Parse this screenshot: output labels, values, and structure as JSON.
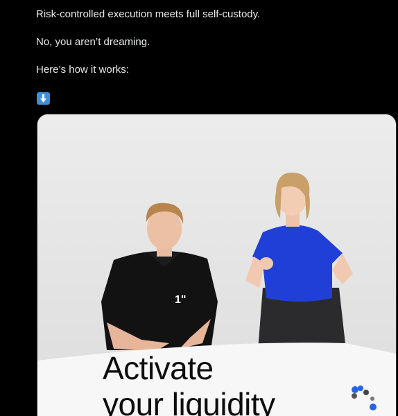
{
  "tweet": {
    "lines": [
      "Risk-controlled execution meets full self-custody.",
      "No, you aren’t dreaming.",
      "Here’s how it works:"
    ],
    "emoji": "down-arrow-emoji"
  },
  "media": {
    "caption_line1": "Activate",
    "caption_line2": "your liquidity",
    "shirt_logo": "1\"",
    "colors": {
      "background": "#e6e6e6",
      "man_shirt": "#111111",
      "woman_shirt": "#1f3fd6",
      "table": "#f7f7f7",
      "logo_blue": "#2563eb"
    }
  }
}
